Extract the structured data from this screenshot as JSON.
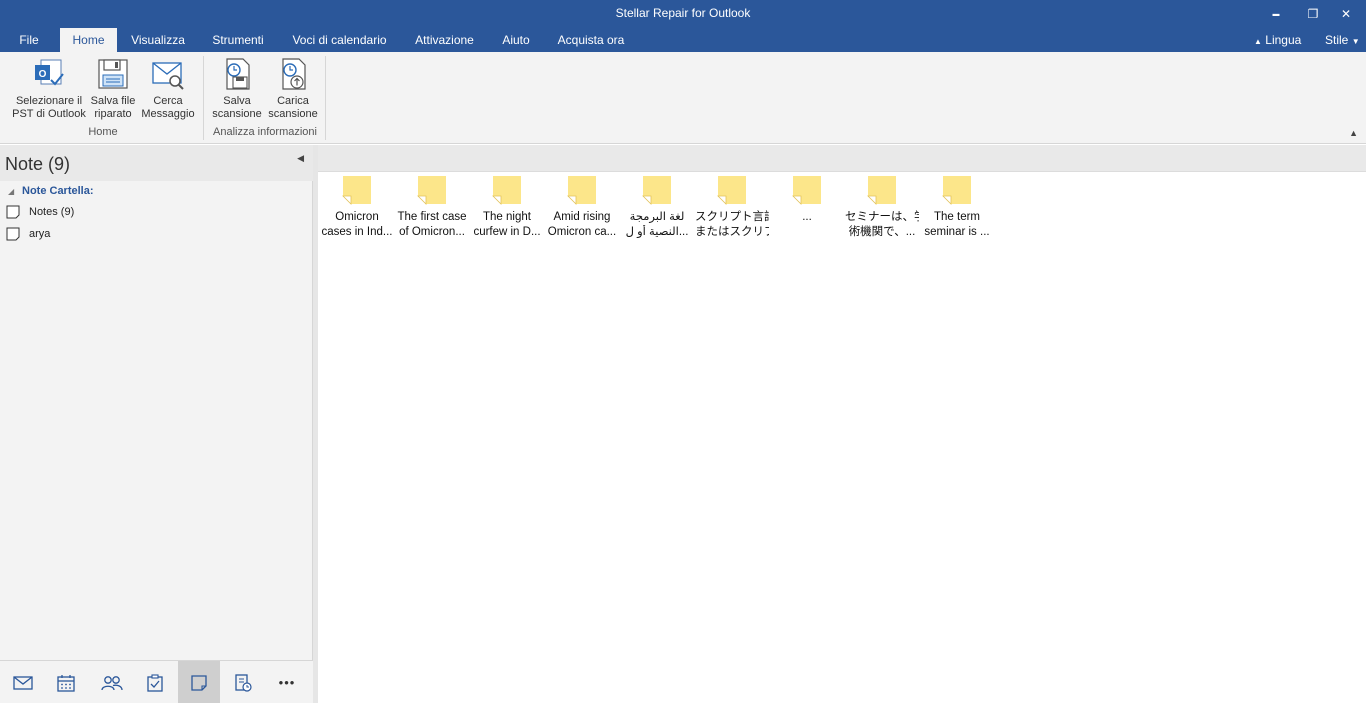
{
  "window": {
    "title": "Stellar Repair for Outlook",
    "minimize_glyph": "▬",
    "restore_glyph": "❐",
    "close_glyph": "✕"
  },
  "menu": {
    "tabs": [
      "File",
      "Home",
      "Visualizza",
      "Strumenti",
      "Voci di calendario",
      "Attivazione",
      "Aiuto",
      "Acquista ora"
    ],
    "active_tab": "Home",
    "lingua": "Lingua",
    "stile": "Stile"
  },
  "ribbon": {
    "groups": [
      {
        "label": "Home",
        "buttons": [
          {
            "line1": "Selezionare il",
            "line2": "PST di Outlook"
          },
          {
            "line1": "Salva file",
            "line2": "riparato"
          },
          {
            "line1": "Cerca",
            "line2": "Messaggio"
          }
        ]
      },
      {
        "label": "Analizza informazioni",
        "buttons": [
          {
            "line1": "Salva",
            "line2": "scansione"
          },
          {
            "line1": "Carica",
            "line2": "scansione"
          }
        ]
      }
    ]
  },
  "left_pane": {
    "title": "Note (9)",
    "folder_root": "Note Cartella:",
    "folders": [
      {
        "label": "Notes (9)"
      },
      {
        "label": "arya"
      }
    ]
  },
  "bottom_nav": {
    "items": [
      "mail-icon",
      "calendar-icon",
      "contacts-icon",
      "tasks-icon",
      "notes-icon",
      "journal-icon",
      "more-icon"
    ],
    "active": "notes-icon",
    "more_glyph": "•••"
  },
  "notes": [
    {
      "line1": "Omicron",
      "line2": "cases in Ind..."
    },
    {
      "line1": "The first case",
      "line2": "of Omicron..."
    },
    {
      "line1": "The night",
      "line2": "curfew in D..."
    },
    {
      "line1": "Amid rising",
      "line2": "Omicron ca..."
    },
    {
      "line1": "لغة البرمجة",
      "line2": "النصية أو ل..."
    },
    {
      "line1": "スクリプト言語",
      "line2": "またはスクリプ..."
    },
    {
      "line1": "",
      "line2": "..."
    },
    {
      "line1": "セミナーは、学",
      "line2": "術機関で、..."
    },
    {
      "line1": "The term",
      "line2": "seminar is ..."
    }
  ],
  "colors": {
    "accent": "#2b579a",
    "note_yellow": "#fce68a"
  }
}
